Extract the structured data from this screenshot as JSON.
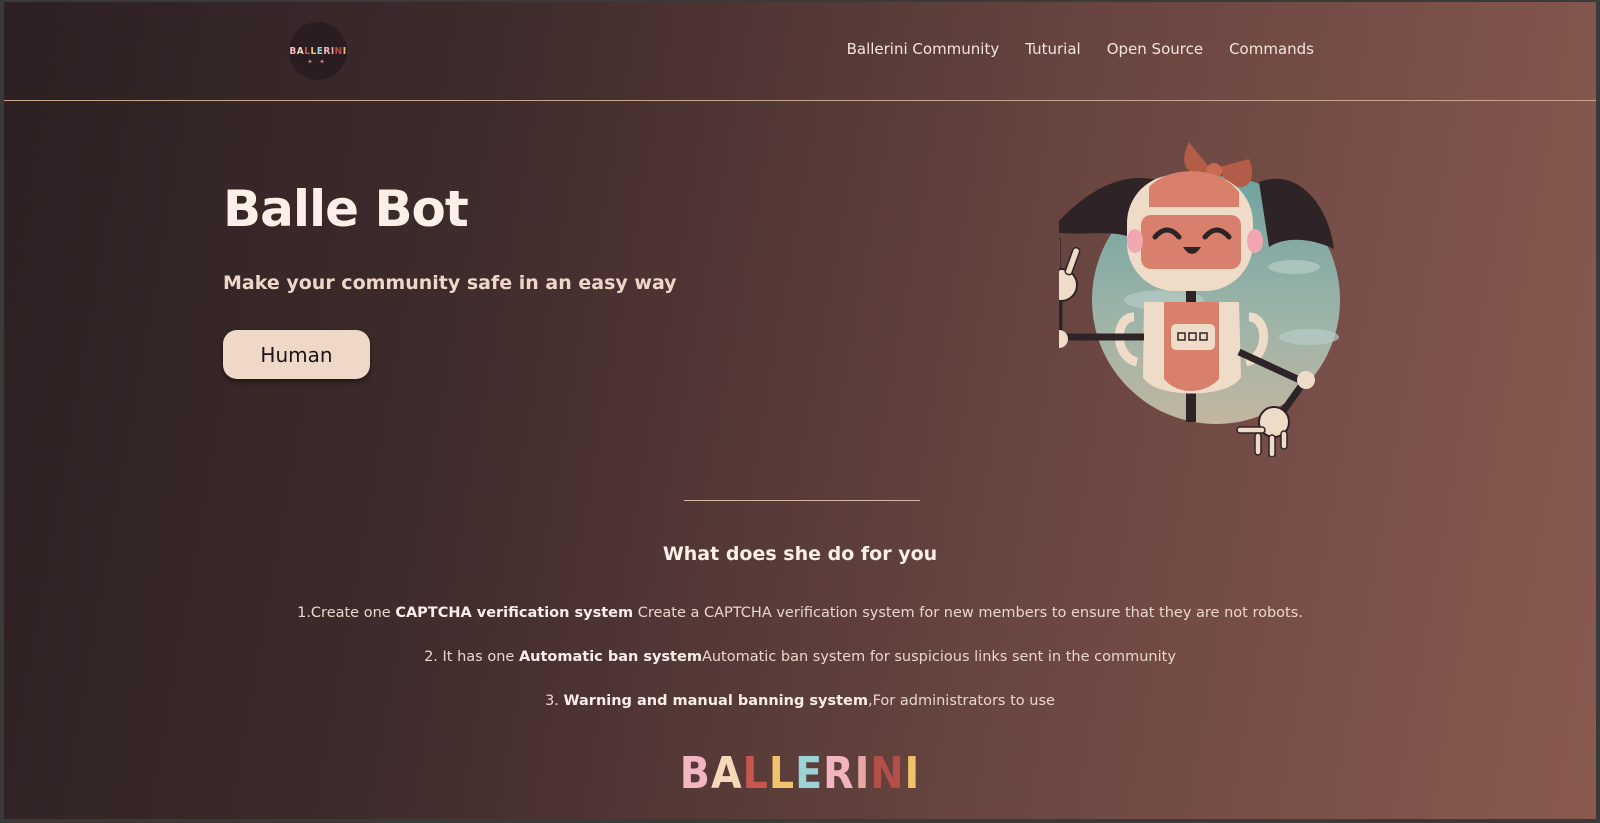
{
  "brand": {
    "logo_text": "BALLERINI",
    "letter_colors": [
      "#f3b6c0",
      "#f6d9b8",
      "#c7574f",
      "#f0c36a",
      "#9ad4d6",
      "#f3b6c0",
      "#e8a7a3",
      "#b44e4a",
      "#f0c36a"
    ]
  },
  "nav": {
    "items": [
      "Ballerini Community",
      "Tuturial",
      "Open Source",
      "Commands"
    ]
  },
  "hero": {
    "title": "Balle Bot",
    "subtitle": "Make your community safe in an easy way",
    "button_label": "Human"
  },
  "features": {
    "title": "What does she do for you",
    "items": [
      {
        "prefix": "1.Create one ",
        "bold": "CAPTCHA verification system",
        "suffix": " Create a CAPTCHA verification system for new members to ensure that they are not robots."
      },
      {
        "prefix": "2. It has one ",
        "bold": "Automatic ban system",
        "suffix": "Automatic ban system for suspicious links sent in the community"
      },
      {
        "prefix": "3. ",
        "bold": "Warning and manual banning system",
        "suffix": ",For administrators to use"
      }
    ]
  },
  "colors": {
    "background_start": "#2c2022",
    "background_end": "#8a5a51",
    "accent_cream": "#eed8c8",
    "robot_pink": "#d9806c"
  },
  "illustration": {
    "icon": "robot-girl-illustration"
  }
}
